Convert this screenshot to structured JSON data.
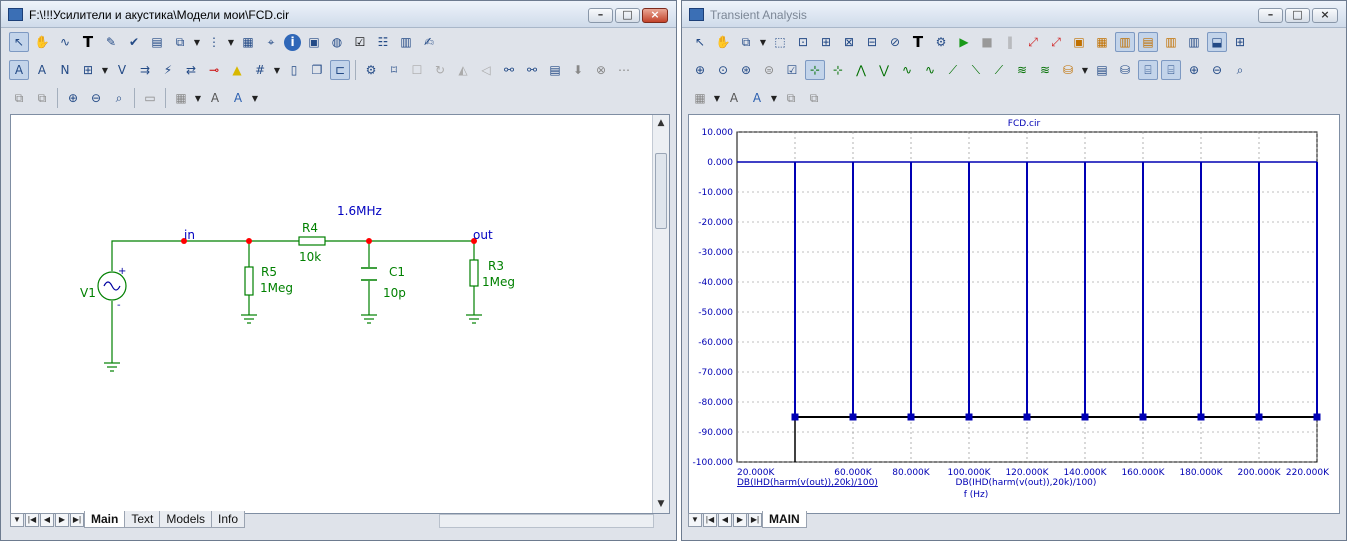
{
  "left_window": {
    "title": "F:\\!!!Усилители и акустика\\Модели мои\\FCD.cir",
    "schematic": {
      "frequency_label": "1.6MHz",
      "node_in": "in",
      "node_out": "out",
      "source": {
        "name": "V1",
        "plus": "+",
        "minus": "-"
      },
      "components": [
        {
          "name": "R5",
          "value": "1Meg"
        },
        {
          "name": "R4",
          "value": "10k"
        },
        {
          "name": "C1",
          "value": "10p"
        },
        {
          "name": "R3",
          "value": "1Meg"
        }
      ]
    },
    "tabs": [
      "Main",
      "Text",
      "Models",
      "Info"
    ],
    "active_tab": "Main"
  },
  "right_window": {
    "title": "Transient Analysis",
    "tabs": [
      "MAIN"
    ],
    "active_tab": "MAIN"
  },
  "window_buttons": {
    "minimize": "–",
    "restore": "□",
    "close": "×"
  },
  "toolbar_icons": {
    "left_row1": [
      "select-arrow-icon",
      "pan-hand-icon",
      "wire-icon",
      "text-tool-icon",
      "probe-icon",
      "flag-icon",
      "bom-icon",
      "component-icon",
      "dropdown-icon",
      "hierarchy-icon",
      "grid-list-icon",
      "find-icon",
      "info-icon",
      "help-icon",
      "globe-icon",
      "checkbox-icon",
      "properties-icon",
      "notebook-icon",
      "edit-icon"
    ],
    "left_row2": [
      "attributes-icon",
      "display-icon",
      "node-numbers-icon",
      "pin-icon",
      "voltage-icon",
      "current-icon",
      "power-icon",
      "condition-icon",
      "node-voltage-icon",
      "warning-icon",
      "grid-icon",
      "page-icon",
      "copy-page-icon",
      "snap-icon",
      "settings-icon",
      "rubberband-icon",
      "select-box-icon",
      "rotate-icon",
      "mirror-icon",
      "flip-icon",
      "binoculars-icon",
      "find-next-icon",
      "table-icon",
      "stop-icon",
      "close-circle-icon",
      "more-icon"
    ],
    "left_row3": [
      "bring-front-icon",
      "send-back-icon",
      "zoom-in-icon",
      "zoom-out-icon",
      "zoom-fit-icon",
      "print-icon",
      "tile-icon",
      "font-icon",
      "color-icon"
    ],
    "right_row1": [
      "select-arrow-icon",
      "pan-hand-icon",
      "component-icon",
      "dropdown-icon",
      "scale-icon",
      "shrink-icon",
      "expand-icon",
      "autoscale-icon",
      "plot-icon",
      "text-tool-icon",
      "properties-icon",
      "run-icon",
      "stop-icon",
      "pause-icon",
      "graph-lines-icon",
      "graph-points-icon",
      "layout1-icon",
      "layout2-icon",
      "layout3-icon",
      "layout4-icon",
      "layout5-icon",
      "layout6-icon",
      "split-icon",
      "tile-icon"
    ],
    "right_row2": [
      "zoom-in-icon",
      "zoom-out-icon",
      "zoom-fit-icon",
      "zoom-previous-icon",
      "properties-icon",
      "cursor-mode-icon",
      "peak-icon",
      "valley-icon",
      "high-icon",
      "low-icon",
      "inflection-icon",
      "top-icon",
      "bottom-icon",
      "global-high-icon",
      "global-low-icon",
      "settings-icon",
      "page-icon",
      "tokens-icon",
      "data-points-icon",
      "magnify-icon",
      "zoom-box-icon",
      "zoom-fit2-icon"
    ],
    "right_row3": [
      "tile-icon",
      "font-icon",
      "color-icon",
      "bring-front-icon",
      "send-back-icon"
    ]
  },
  "chart_data": {
    "type": "bar",
    "title": "FCD.cir",
    "xlabel": "f (Hz)",
    "ylabel": "",
    "legend": [
      "DB(IHD(harm(v(out)),20k)/100)"
    ],
    "x_tick_labels": [
      "20.000K",
      "60.000K",
      "80.000K",
      "100.000K",
      "120.000K",
      "140.000K",
      "160.000K",
      "180.000K",
      "200.000K",
      "220.000K"
    ],
    "y_tick_labels": [
      "10.000",
      "0.000",
      "-10.000",
      "-20.000",
      "-30.000",
      "-40.000",
      "-50.000",
      "-60.000",
      "-70.000",
      "-80.000",
      "-90.000",
      "-100.000"
    ],
    "xlim": [
      20000,
      220000
    ],
    "ylim": [
      -100,
      10
    ],
    "grid": true,
    "series": [
      {
        "name": "DB(IHD(harm(v(out)),20k)/100)",
        "color": "#0000b4",
        "x": [
          40000,
          60000,
          80000,
          100000,
          120000,
          140000,
          160000,
          180000,
          200000,
          220000
        ],
        "values": [
          0,
          0,
          0,
          0,
          0,
          0,
          0,
          0,
          0,
          0
        ],
        "baseline": -85
      }
    ]
  },
  "colors": {
    "wire": "#008000",
    "node_dot": "#ff0000",
    "component_label": "#008000",
    "node_label": "#0000c0",
    "plot_series": "#0000b4",
    "grid": "#808080"
  }
}
